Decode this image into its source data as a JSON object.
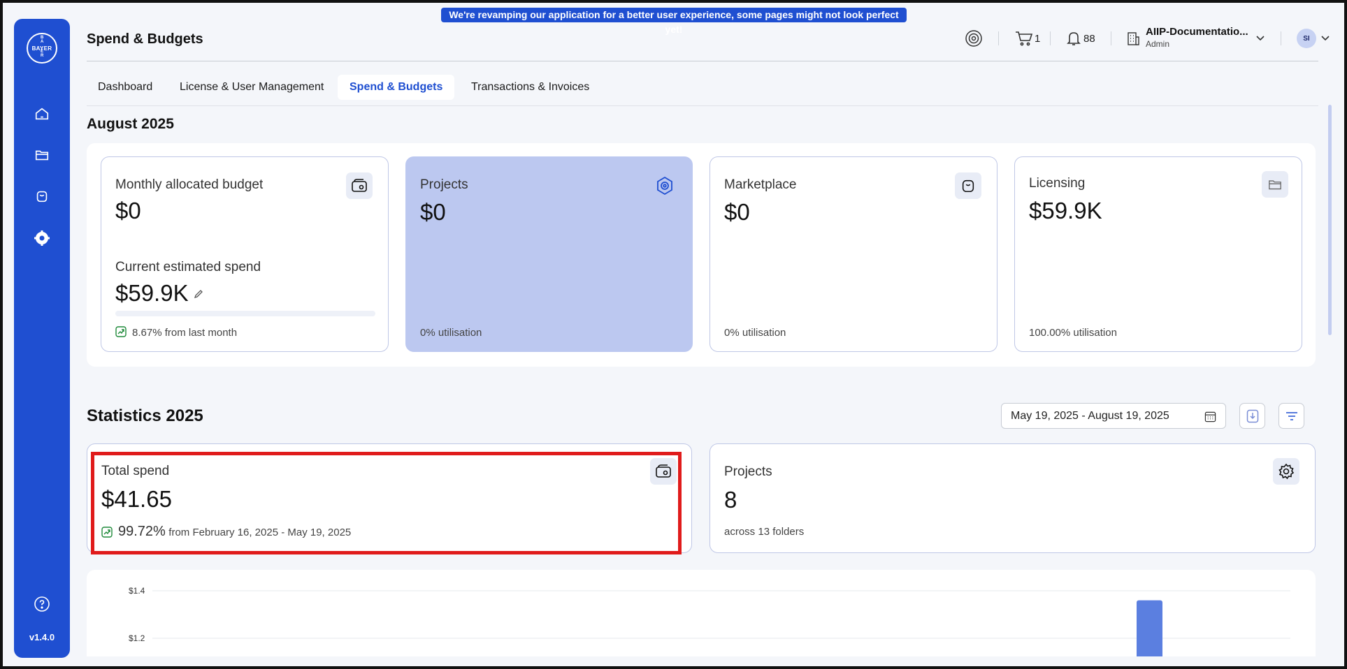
{
  "banner": "We're revamping our application for a better user experience, some pages might not look perfect yet!",
  "sidebar": {
    "logo_horizontal": "BAYER",
    "logo_vertical": [
      "B",
      "A",
      "Y",
      "E",
      "R"
    ],
    "items": [
      {
        "icon": "home-icon"
      },
      {
        "icon": "folder-icon"
      },
      {
        "icon": "marketplace-bag-icon"
      },
      {
        "icon": "settings-gear-icon"
      }
    ],
    "help_icon": "help-circle-icon",
    "version": "v1.4.0"
  },
  "header": {
    "title": "Spend & Budgets",
    "cart_count": "1",
    "notifications_count": "88",
    "org_name": "AIIP-Documentatio...",
    "org_role": "Admin",
    "avatar_initials": "SI"
  },
  "tabs": [
    {
      "label": "Dashboard",
      "active": false
    },
    {
      "label": "License & User Management",
      "active": false
    },
    {
      "label": "Spend & Budgets",
      "active": true
    },
    {
      "label": "Transactions & Invoices",
      "active": false
    }
  ],
  "month_section": {
    "title": "August 2025",
    "budget_card": {
      "label": "Monthly allocated budget",
      "value": "$0",
      "spend_label": "Current estimated spend",
      "spend_value": "$59.9K",
      "progress": 0,
      "change": "8.67% from last month"
    },
    "projects_card": {
      "label": "Projects",
      "value": "$0",
      "foot": "0% utilisation"
    },
    "marketplace_card": {
      "label": "Marketplace",
      "value": "$0",
      "foot": "0% utilisation"
    },
    "licensing_card": {
      "label": "Licensing",
      "value": "$59.9K",
      "foot": "100.00% utilisation"
    }
  },
  "stats_section": {
    "title": "Statistics 2025",
    "date_range": "May 19, 2025 - August 19, 2025",
    "total_spend": {
      "label": "Total spend",
      "value": "$41.65",
      "change_pct": "99.72%",
      "change_text": "from February 16, 2025 - May 19, 2025"
    },
    "projects": {
      "label": "Projects",
      "value": "8",
      "foot": "across 13 folders"
    }
  },
  "colors": {
    "primary": "#1f4fd1",
    "highlight_card": "#bcc8f0",
    "bar": "#5b7fe0",
    "positive": "#1f8a3a",
    "annotation": "#e01b1b"
  },
  "chart_data": {
    "type": "bar",
    "y_ticks": [
      "$1.4",
      "$1.2"
    ],
    "ylim": [
      1.2,
      1.4
    ],
    "bars": [
      {
        "value": 1.36
      }
    ]
  }
}
